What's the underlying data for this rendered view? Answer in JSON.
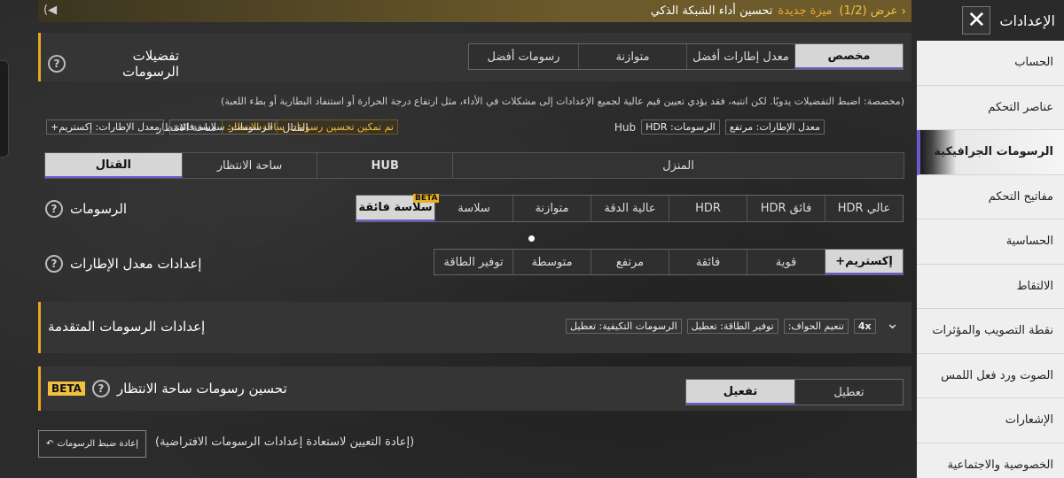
{
  "announcement": {
    "offer": "عرض (1/2)",
    "new_feature": "ميزة جديدة",
    "title": "تحسين أداء الشبكة الذكي"
  },
  "sidebar": {
    "title": "الإعدادات",
    "items": [
      {
        "label": "الحساب"
      },
      {
        "label": "عناصر التحكم"
      },
      {
        "label": "الرسومات الجرافيكية",
        "active": true
      },
      {
        "label": "مفاتيح التحكم"
      },
      {
        "label": "الحساسية"
      },
      {
        "label": "الالتقاط"
      },
      {
        "label": "نقطة التصويب والمؤثرات"
      },
      {
        "label": "الصوت ورد فعل اللمس"
      },
      {
        "label": "الإشعارات"
      },
      {
        "label": "الخصوصية والاجتماعية"
      }
    ]
  },
  "graphics_pref": {
    "title": "تفضيلات الرسومات",
    "options": [
      "مخصص",
      "معدل إطارات أفضل",
      "متوازنة",
      "رسومات أفضل"
    ],
    "selected": "مخصص",
    "hint": "(مخصصة: اضبط التفضيلات يدويًا. لكن انتبه، فقد يؤدي تعيين قيم عالية لجميع الإعدادات إلى مشكلات في الأداء، مثل ارتفاع درجة الحرارة أو استنفاد البطارية أو بطء اللعبة)",
    "summary": {
      "hub_label": "Hub",
      "hub_graphics": "الرسومات: HDR",
      "hub_fps": "معدل الإطارات: مرتفع",
      "lobby_label": "ساحة الانتظار",
      "lobby_status": "تم تمكين تحسين رسومات ساحة الانتظار.",
      "combat_label": "القتال",
      "combat_fps": "معدل الإطارات: إكستريم+",
      "combat_graphics": "الرسومات: سلاسة فائقة"
    }
  },
  "mode_tabs": {
    "tabs": [
      "المنزل",
      "HUB",
      "ساحة الانتظار",
      "القتال"
    ],
    "selected": "القتال"
  },
  "graphics": {
    "label": "الرسومات",
    "options": [
      "عالي HDR",
      "فائق HDR",
      "HDR",
      "عالية الدقة",
      "متوازنة",
      "سلاسة",
      "سلاسة فائقة"
    ],
    "selected": "سلاسة فائقة",
    "beta_tag": "BETA"
  },
  "fps": {
    "label": "إعدادات معدل الإطارات",
    "options": [
      "إكستريم+",
      "قوية",
      "فائقة",
      "مرتفع",
      "متوسطة",
      "توفير الطاقة"
    ],
    "selected": "إكستريم+"
  },
  "advanced": {
    "title": "إعدادات الرسومات المتقدمة",
    "tags": [
      "الرسومات التكيفية: تعطيل",
      "توفير الطاقة: تعطيل",
      "تنعيم الحواف:",
      "4x"
    ]
  },
  "lobby_enhance": {
    "title": "تحسين رسومات ساحة الانتظار",
    "beta": "BETA",
    "options": [
      "تعطيل",
      "تفعيل"
    ],
    "selected": "تفعيل"
  },
  "reset": {
    "button_label": "إعادة ضبط الرسومات",
    "description": "(إعادة التعيين لاستعادة إعدادات الرسومات الافتراضية)"
  }
}
